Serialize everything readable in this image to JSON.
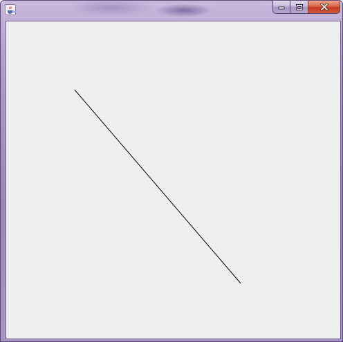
{
  "window": {
    "title": "",
    "icon": "java-cup-icon",
    "controls": {
      "minimize": "minimize-icon",
      "maximize": "maximize-icon",
      "close": "close-icon"
    },
    "client_background": "#efefef"
  },
  "canvas": {
    "shapes": [
      {
        "kind": "line",
        "color": "#000000"
      }
    ]
  }
}
